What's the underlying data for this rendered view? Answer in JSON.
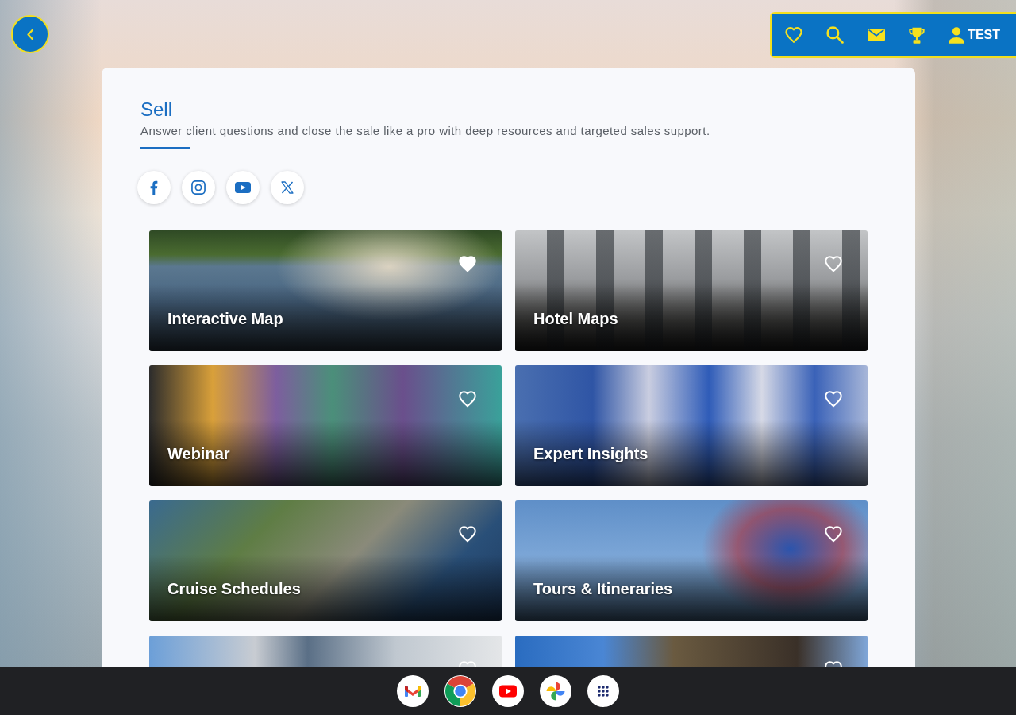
{
  "nav": {
    "account_label": "TEST"
  },
  "section": {
    "title": "Sell",
    "subtitle": "Answer client questions and close the sale like a pro with deep resources and targeted sales support."
  },
  "tiles": [
    {
      "title": "Interactive Map",
      "favorite": true
    },
    {
      "title": "Hotel Maps",
      "favorite": false
    },
    {
      "title": "Webinar",
      "favorite": false
    },
    {
      "title": "Expert Insights",
      "favorite": false
    },
    {
      "title": "Cruise Schedules",
      "favorite": false
    },
    {
      "title": "Tours & Itineraries",
      "favorite": false
    },
    {
      "favorite": false
    },
    {
      "favorite": false
    }
  ]
}
